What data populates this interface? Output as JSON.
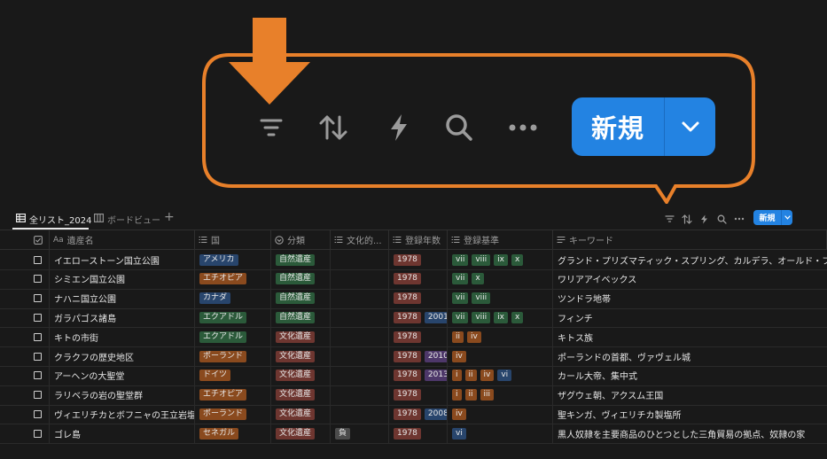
{
  "callout": {
    "colors": {
      "outline": "#e8802a",
      "arrow": "#e8802a"
    },
    "icons": [
      "filter-icon",
      "sort-icon",
      "lightning-icon",
      "search-icon",
      "more-icon"
    ],
    "new_label": "新規"
  },
  "tabs": [
    {
      "label": "全リスト_2024",
      "icon": "table-icon",
      "active": true
    },
    {
      "label": "ボードビュー",
      "icon": "board-icon",
      "active": false
    }
  ],
  "toolbar": {
    "add_view": "+",
    "new_label": "新規"
  },
  "columns": [
    {
      "label": "",
      "icon": "checkbox-icon"
    },
    {
      "label": "遺産名",
      "icon": "title-icon",
      "icon_text": "Aa"
    },
    {
      "label": "国",
      "icon": "list-icon"
    },
    {
      "label": "分類",
      "icon": "select-icon"
    },
    {
      "label": "文化的...",
      "icon": "list-icon"
    },
    {
      "label": "登録年数",
      "icon": "list-icon"
    },
    {
      "label": "登録基準",
      "icon": "list-icon"
    },
    {
      "label": "キーワード",
      "icon": "text-icon"
    }
  ],
  "rows": [
    {
      "name": "イエローストーン国立公園",
      "country": {
        "text": "アメリカ",
        "color": "blue"
      },
      "category": "自然遺産",
      "cultural": [],
      "years": [
        {
          "text": "1978",
          "color": "red"
        }
      ],
      "criteria": [
        {
          "text": "vii",
          "color": "green"
        },
        {
          "text": "viii",
          "color": "green"
        },
        {
          "text": "ix",
          "color": "green"
        },
        {
          "text": "x",
          "color": "green"
        }
      ],
      "keywords": "グランド・プリズマティック・スプリング、カルデラ、オールド・フェー"
    },
    {
      "name": "シミエン国立公園",
      "country": {
        "text": "エチオピア",
        "color": "orange"
      },
      "category": "自然遺産",
      "cultural": [],
      "years": [
        {
          "text": "1978",
          "color": "red"
        }
      ],
      "criteria": [
        {
          "text": "vii",
          "color": "green"
        },
        {
          "text": "x",
          "color": "green"
        }
      ],
      "keywords": "ワリアアイベックス"
    },
    {
      "name": "ナハニ国立公園",
      "country": {
        "text": "カナダ",
        "color": "blue"
      },
      "category": "自然遺産",
      "cultural": [],
      "years": [
        {
          "text": "1978",
          "color": "red"
        }
      ],
      "criteria": [
        {
          "text": "vii",
          "color": "green"
        },
        {
          "text": "viii",
          "color": "green"
        }
      ],
      "keywords": "ツンドラ地帯"
    },
    {
      "name": "ガラパゴス諸島",
      "country": {
        "text": "エクアドル",
        "color": "green"
      },
      "category": "自然遺産",
      "cultural": [],
      "years": [
        {
          "text": "1978",
          "color": "red"
        },
        {
          "text": "2001",
          "color": "blue"
        }
      ],
      "criteria": [
        {
          "text": "vii",
          "color": "green"
        },
        {
          "text": "viii",
          "color": "green"
        },
        {
          "text": "ix",
          "color": "green"
        },
        {
          "text": "x",
          "color": "green"
        }
      ],
      "keywords": "フィンチ"
    },
    {
      "name": "キトの市街",
      "country": {
        "text": "エクアドル",
        "color": "green"
      },
      "category": "文化遺産",
      "cultural": [],
      "years": [
        {
          "text": "1978",
          "color": "red"
        }
      ],
      "criteria": [
        {
          "text": "ii",
          "color": "orange"
        },
        {
          "text": "iv",
          "color": "orange"
        }
      ],
      "keywords": "キトス族"
    },
    {
      "name": "クラクフの歴史地区",
      "country": {
        "text": "ポーランド",
        "color": "orange"
      },
      "category": "文化遺産",
      "cultural": [],
      "years": [
        {
          "text": "1978",
          "color": "red"
        },
        {
          "text": "2010",
          "color": "purple"
        }
      ],
      "criteria": [
        {
          "text": "iv",
          "color": "orange"
        }
      ],
      "keywords": "ポーランドの首都、ヴァヴェル城"
    },
    {
      "name": "アーヘンの大聖堂",
      "country": {
        "text": "ドイツ",
        "color": "orange"
      },
      "category": "文化遺産",
      "cultural": [],
      "years": [
        {
          "text": "1978",
          "color": "red"
        },
        {
          "text": "2013",
          "color": "purple"
        }
      ],
      "criteria": [
        {
          "text": "i",
          "color": "orange"
        },
        {
          "text": "ii",
          "color": "orange"
        },
        {
          "text": "iv",
          "color": "orange"
        },
        {
          "text": "vi",
          "color": "blue"
        }
      ],
      "keywords": "カール大帝、集中式"
    },
    {
      "name": "ラリベラの岩の聖堂群",
      "country": {
        "text": "エチオピア",
        "color": "orange"
      },
      "category": "文化遺産",
      "cultural": [],
      "years": [
        {
          "text": "1978",
          "color": "red"
        }
      ],
      "criteria": [
        {
          "text": "i",
          "color": "orange"
        },
        {
          "text": "ii",
          "color": "orange"
        },
        {
          "text": "iii",
          "color": "orange"
        }
      ],
      "keywords": "ザグウェ朝、アクスム王国"
    },
    {
      "name": "ヴィエリチカとボフニャの王立岩塩坑",
      "country": {
        "text": "ポーランド",
        "color": "orange"
      },
      "category": "文化遺産",
      "cultural": [],
      "years": [
        {
          "text": "1978",
          "color": "red"
        },
        {
          "text": "2008",
          "color": "blue"
        }
      ],
      "criteria": [
        {
          "text": "iv",
          "color": "orange"
        }
      ],
      "keywords": "聖キンガ、ヴィエリチカ製塩所"
    },
    {
      "name": "ゴレ島",
      "country": {
        "text": "セネガル",
        "color": "orange"
      },
      "category": "文化遺産",
      "cultural": [
        {
          "text": "負",
          "color": "gray"
        }
      ],
      "years": [
        {
          "text": "1978",
          "color": "red"
        }
      ],
      "criteria": [
        {
          "text": "vi",
          "color": "blue"
        }
      ],
      "keywords": "黒人奴隷を主要商品のひとつとした三角貿易の拠点、奴隷の家"
    }
  ]
}
